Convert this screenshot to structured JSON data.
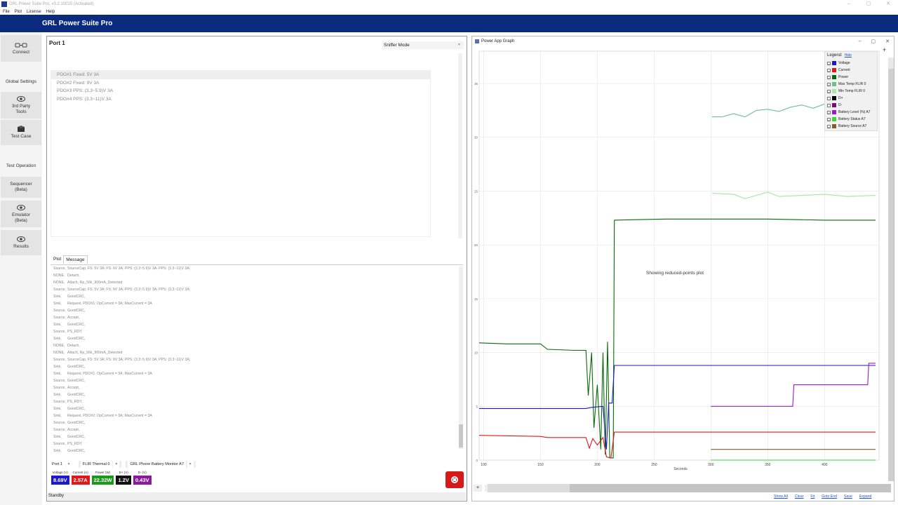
{
  "window": {
    "title": "GRL Power Suite Pro, v3.2.10015 (Activated)",
    "min": "–",
    "max": "▢",
    "close": "✕"
  },
  "menu": [
    "File",
    "Plot",
    "License",
    "Help"
  ],
  "app_title": "GRL Power Suite Pro",
  "nav": {
    "connect": "Connect",
    "global_settings": "Global Settings",
    "third_party": "3rd Party\nTools",
    "test_case": "Test Case",
    "test_operation": "Test Operation",
    "sequencer": "Sequencer\n(Beta)",
    "emulator": "Emulator\n(Beta)",
    "results": "Results"
  },
  "port": {
    "title": "Port 1",
    "mode": "Sniffer Mode",
    "pdos": [
      "PDO#1 Fixed: 5V 3A",
      "PDO#2 Fixed: 9V 3A",
      "PDO#3 PPS: (3.3~5.9)V 3A",
      "PDO#4 PPS: (3.3~11)V 3A"
    ],
    "tabs": [
      "Plot",
      "Message"
    ],
    "messages": [
      [
        "Source,",
        "SourceCap, FS: 5V 3A; FS: 9V 3A; PPS: (3.3~5.9)V 3A; PPS: (3.3~11)V 3A;"
      ],
      [
        "NONE,",
        "Detach,"
      ],
      [
        "NONE,",
        "Attach, Rp_56k_900mA_Detected"
      ],
      [
        "Source,",
        "SourceCap, FS: 5V 3A; FS: 9V 3A; PPS: (3.3~5.9)V 3A; PPS: (3.3~11)V 3A;"
      ],
      [
        "Sink,",
        "GoodCRC,"
      ],
      [
        "Sink,",
        "Request, PDO#1; OpCurrent = 3A; MaxCurrent = 3A"
      ],
      [
        "Source,",
        "GoodCRC,"
      ],
      [
        "Source,",
        "Accept,"
      ],
      [
        "Sink,",
        "GoodCRC,"
      ],
      [
        "Source,",
        "PS_RDY,"
      ],
      [
        "Sink,",
        "GoodCRC,"
      ],
      [
        "NONE,",
        "Detach,"
      ],
      [
        "NONE,",
        "Attach, Rp_56k_900mA_Detected"
      ],
      [
        "Source,",
        "SourceCap, FS: 5V 3A; FS: 9V 3A; PPS: (3.3~5.9)V 3A; PPS: (3.3~11)V 3A;"
      ],
      [
        "Sink,",
        "GoodCRC,"
      ],
      [
        "Sink,",
        "Request, PDO#1; OpCurrent = 3A; MaxCurrent = 3A"
      ],
      [
        "Source,",
        "GoodCRC,"
      ],
      [
        "Source,",
        "Accept,"
      ],
      [
        "Sink,",
        "GoodCRC,"
      ],
      [
        "Source,",
        "PS_RDY,"
      ],
      [
        "Sink,",
        "GoodCRC,"
      ],
      [
        "Sink,",
        "Request, PDO#2; OpCurrent = 3A; MaxCurrent = 3A"
      ],
      [
        "Source,",
        "GoodCRC,"
      ],
      [
        "Source,",
        "Accept,"
      ],
      [
        "Sink,",
        "GoodCRC,"
      ],
      [
        "Source,",
        "PS_RDY,"
      ],
      [
        "Sink,",
        "GoodCRC,"
      ]
    ],
    "bottom_tabs": [
      "Port 1",
      "FLIR Thermal 0",
      "GRL Phone Battery Monitor A7"
    ],
    "tab_close": "×",
    "meters": [
      {
        "label": "Voltage (V)",
        "value": "8.69V",
        "color": "#1a1acc"
      },
      {
        "label": "Current (A)",
        "value": "2.57A",
        "color": "#e01818"
      },
      {
        "label": "Power (W)",
        "value": "22.32W",
        "color": "#1a9a1a"
      },
      {
        "label": "D+ (V)",
        "value": "1.2V",
        "color": "#111111"
      },
      {
        "label": "D- (V)",
        "value": "0.43V",
        "color": "#8a1a9a"
      }
    ],
    "status": "Standby"
  },
  "graph": {
    "title": "Power App Graph",
    "legend_title": "Legend:",
    "legend_hide": "Hide",
    "legend": [
      {
        "name": "Voltage",
        "color": "#1a1acc",
        "checked": true
      },
      {
        "name": "Current",
        "color": "#e01818",
        "checked": true
      },
      {
        "name": "Power",
        "color": "#0a6a0a",
        "checked": true
      },
      {
        "name": "Max Temp FLIR 0",
        "color": "#6fbf8f",
        "checked": true
      },
      {
        "name": "Min Temp FLIR 0",
        "color": "#a6e6a6",
        "checked": true
      },
      {
        "name": "D+",
        "color": "#000000",
        "checked": false
      },
      {
        "name": "D-",
        "color": "#7a0a7a",
        "checked": false
      },
      {
        "name": "Battery Level (%) A7",
        "color": "#9a1ad6",
        "checked": true
      },
      {
        "name": "Battery Status A7",
        "color": "#3ad63a",
        "checked": true
      },
      {
        "name": "Battery Source A7",
        "color": "#8a5a2a",
        "checked": true
      }
    ],
    "reduced_text": "Showing reduced-points plot",
    "zoom_in": "+",
    "zoom_out": "-",
    "links": [
      "Show All",
      "Clear",
      "Fit",
      "Goto End",
      "Save",
      "Expand"
    ],
    "plus": "+",
    "chart_data": {
      "type": "line",
      "xlabel": "Seconds",
      "ylabel": "",
      "xlim": [
        96,
        448
      ],
      "ylim": [
        0,
        38
      ],
      "x_ticks": [
        100,
        150,
        200,
        250,
        300,
        350,
        400
      ],
      "y_ticks": [
        0,
        5,
        10,
        15,
        20,
        25,
        30,
        35
      ],
      "grid": true,
      "series": [
        {
          "name": "Power",
          "color": "#0a6a0a",
          "points": [
            [
              96,
              10.9
            ],
            [
              120,
              10.8
            ],
            [
              150,
              10.8
            ],
            [
              156,
              10.3
            ],
            [
              180,
              10.2
            ],
            [
              190,
              10.2
            ],
            [
              192,
              6
            ],
            [
              195,
              10
            ],
            [
              197,
              3
            ],
            [
              200,
              7
            ],
            [
              203,
              1
            ],
            [
              205,
              10
            ],
            [
              207,
              0.5
            ],
            [
              209,
              11
            ],
            [
              211,
              0.2
            ],
            [
              214,
              0.2
            ],
            [
              215,
              22.3
            ],
            [
              260,
              22.4
            ],
            [
              300,
              22.4
            ],
            [
              350,
              22.4
            ],
            [
              400,
              22.3
            ],
            [
              445,
              22.3
            ]
          ]
        },
        {
          "name": "Voltage",
          "color": "#1a1acc",
          "points": [
            [
              96,
              4.8
            ],
            [
              150,
              4.8
            ],
            [
              190,
              4.8
            ],
            [
              195,
              4.9
            ],
            [
              205,
              5
            ],
            [
              208,
              1
            ],
            [
              210,
              5.3
            ],
            [
              213,
              5.3
            ],
            [
              215,
              8.8
            ],
            [
              300,
              8.8
            ],
            [
              400,
              8.8
            ],
            [
              445,
              8.8
            ]
          ]
        },
        {
          "name": "Current",
          "color": "#e01818",
          "points": [
            [
              96,
              2.3
            ],
            [
              150,
              2.2
            ],
            [
              156,
              2.1
            ],
            [
              190,
              2.1
            ],
            [
              193,
              1.1
            ],
            [
              196,
              2
            ],
            [
              200,
              1.4
            ],
            [
              205,
              2.1
            ],
            [
              208,
              0.3
            ],
            [
              212,
              0.2
            ],
            [
              215,
              2.6
            ],
            [
              300,
              2.6
            ],
            [
              400,
              2.6
            ],
            [
              445,
              2.6
            ]
          ]
        },
        {
          "name": "Max Temp FLIR 0",
          "color": "#6fbf8f",
          "points": [
            [
              301,
              31.9
            ],
            [
              310,
              31.9
            ],
            [
              320,
              32.2
            ],
            [
              330,
              31.9
            ],
            [
              340,
              32.5
            ],
            [
              350,
              32.6
            ],
            [
              360,
              32.4
            ],
            [
              370,
              32.8
            ],
            [
              380,
              33
            ],
            [
              390,
              32.7
            ],
            [
              400,
              33.1
            ],
            [
              410,
              33
            ],
            [
              420,
              32.8
            ],
            [
              430,
              33.2
            ],
            [
              445,
              33.4
            ]
          ]
        },
        {
          "name": "Min Temp FLIR 0",
          "color": "#a6e6a6",
          "points": [
            [
              301,
              24.8
            ],
            [
              320,
              24.7
            ],
            [
              330,
              24.3
            ],
            [
              340,
              24.6
            ],
            [
              350,
              24.9
            ],
            [
              360,
              24.5
            ],
            [
              380,
              24.6
            ],
            [
              400,
              24.7
            ],
            [
              420,
              24.5
            ],
            [
              445,
              24.6
            ]
          ]
        },
        {
          "name": "Battery Level (%) A7",
          "color": "#9a1ad6",
          "points": [
            [
              300,
              5
            ],
            [
              372,
              5
            ],
            [
              373,
              7
            ],
            [
              438,
              7
            ],
            [
              439,
              9
            ],
            [
              445,
              9
            ]
          ]
        },
        {
          "name": "Battery Status A7",
          "color": "#3ad63a",
          "points": [
            [
              300,
              0
            ],
            [
              445,
              0
            ]
          ]
        },
        {
          "name": "Battery Source A7",
          "color": "#8a5a2a",
          "points": [
            [
              300,
              1
            ],
            [
              445,
              1
            ]
          ]
        }
      ]
    }
  }
}
